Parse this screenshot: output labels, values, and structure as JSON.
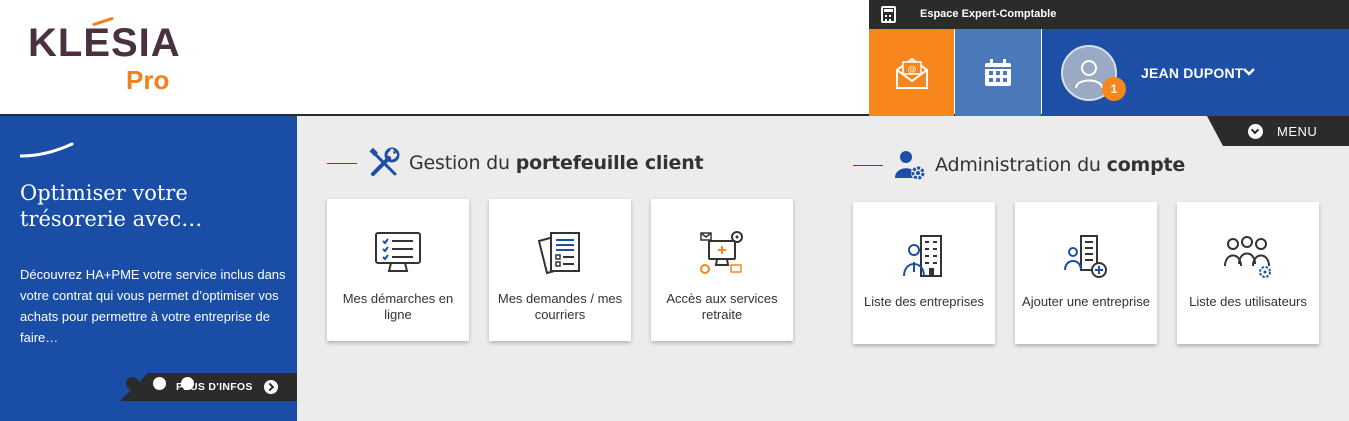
{
  "header": {
    "logo_main": "KLESIA",
    "logo_sub": "Pro",
    "topbar_label": "Espace Expert-Comptable",
    "user_name": "JEAN DUPONT",
    "notification_count": "1",
    "menu_label": "MENU"
  },
  "promo": {
    "title": "Optimiser votre trésorerie avec…",
    "text": "Découvrez HA+PME votre service inclus dans votre contrat qui vous permet d’optimiser vos achats pour permettre à votre entreprise de faire…",
    "more_label": "PLUS D'INFOS"
  },
  "sections": {
    "portfolio": {
      "title_prefix": "Gestion du ",
      "title_bold": "portefeuille client",
      "cards": [
        {
          "label": "Mes démarches en ligne"
        },
        {
          "label": "Mes demandes / mes courriers"
        },
        {
          "label": "Accès aux services retraite"
        }
      ]
    },
    "admin": {
      "title_prefix": "Administration du ",
      "title_bold": "compte",
      "cards": [
        {
          "label": "Liste des entreprises"
        },
        {
          "label": "Ajouter une entreprise"
        },
        {
          "label": "Liste des utilisateurs"
        }
      ]
    }
  },
  "colors": {
    "brand_blue": "#1d4fa6",
    "brand_orange": "#f7871c",
    "dark": "#2b2b2b"
  }
}
